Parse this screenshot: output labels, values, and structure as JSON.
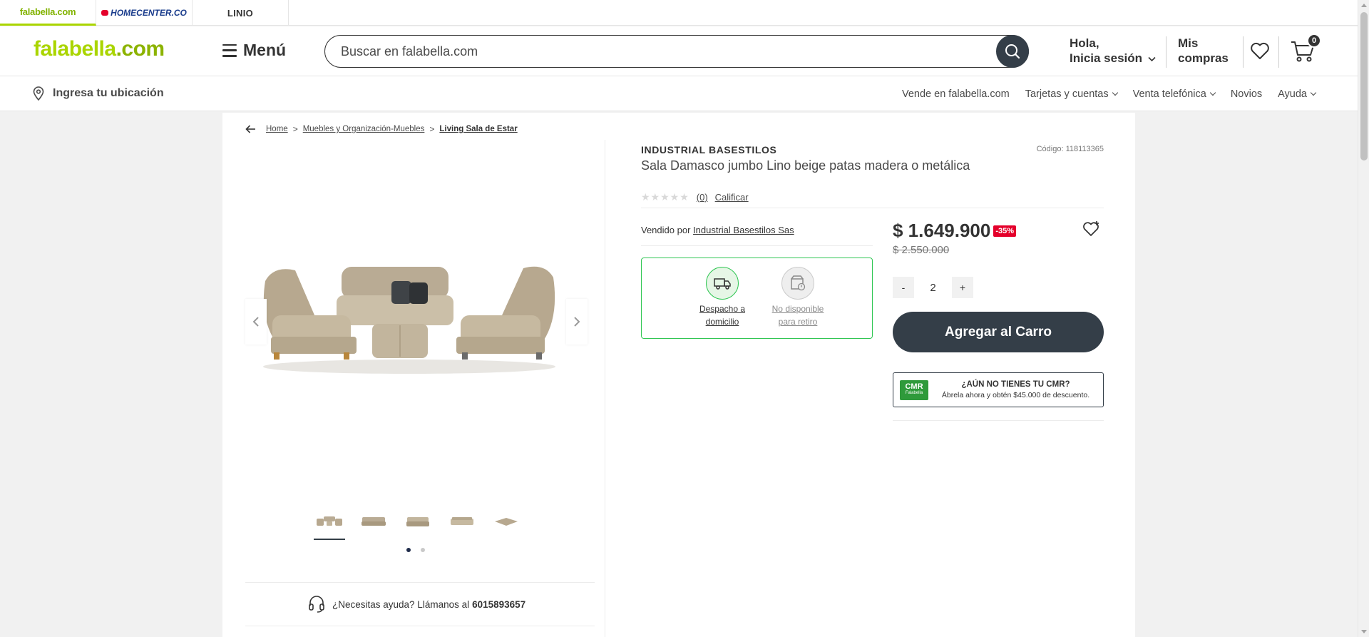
{
  "brand_tabs": [
    "falabella.com",
    "HOMECENTER.CO",
    "LINIO"
  ],
  "header": {
    "logo_text": "falabella",
    "logo_suffix": ".com",
    "menu_label": "Menú",
    "search_placeholder": "Buscar en falabella.com",
    "greeting": "Hola,",
    "login_label": "Inicia sesión",
    "purchases_line1": "Mis",
    "purchases_line2": "compras",
    "cart_count": "0"
  },
  "subnav": {
    "location_label": "Ingresa tu ubicación",
    "links": [
      "Vende en falabella.com",
      "Tarjetas y cuentas",
      "Venta telefónica",
      "Novios",
      "Ayuda"
    ]
  },
  "breadcrumb": [
    "Home",
    "Muebles y Organización-Muebles",
    "Living Sala de Estar"
  ],
  "product": {
    "brand": "INDUSTRIAL BASESTILOS",
    "code_label": "Código: 118113365",
    "title": "Sala Damasco jumbo Lino beige patas madera o metálica",
    "rating_stars": "★★★★★",
    "rating_count": "(0)",
    "rate_label": "Calificar",
    "sold_by_prefix": "Vendido por",
    "seller": "Industrial Basestilos Sas",
    "delivery": {
      "home_line1": "Despacho a",
      "home_line2": "domicilio",
      "pickup_line1": "No disponible",
      "pickup_line2": "para retiro"
    },
    "price": "$ 1.649.900",
    "discount": "-35%",
    "old_price": "$ 2.550.000",
    "quantity": "2",
    "qty_minus": "-",
    "qty_plus": "+",
    "add_to_cart": "Agregar al Carro",
    "cmr_logo": "CMR",
    "cmr_logo_sub": "Falabella",
    "cmr_title": "¿AÚN NO TIENES TU CMR?",
    "cmr_sub": "Ábrela ahora y obtén $45.000 de descuento."
  },
  "help": {
    "text": "¿Necesitas ayuda? Llámanos al",
    "phone": "6015893657"
  },
  "colors": {
    "brand_green": "#aad500",
    "dark": "#343e48",
    "discount_red": "#e4002b",
    "delivery_green": "#30c653"
  }
}
